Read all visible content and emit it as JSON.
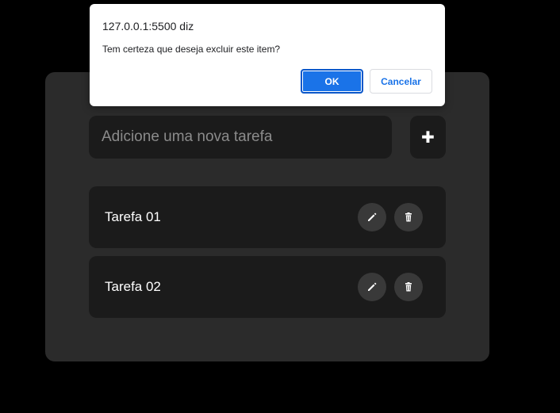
{
  "dialog": {
    "title": "127.0.0.1:5500 diz",
    "message": "Tem certeza que deseja excluir este item?",
    "ok_label": "OK",
    "cancel_label": "Cancelar"
  },
  "form": {
    "placeholder": "Adicione uma nova tarefa",
    "value": "",
    "add_label": "✚"
  },
  "tasks": [
    {
      "label": "Tarefa 01",
      "edit_icon": "pencil-icon",
      "delete_icon": "trash-icon"
    },
    {
      "label": "Tarefa 02",
      "edit_icon": "pencil-icon",
      "delete_icon": "trash-icon"
    }
  ],
  "colors": {
    "background": "#000000",
    "card": "#2b2b2b",
    "field": "#1b1b1b",
    "icon_button": "#393939",
    "accent": "#1a73e8"
  }
}
